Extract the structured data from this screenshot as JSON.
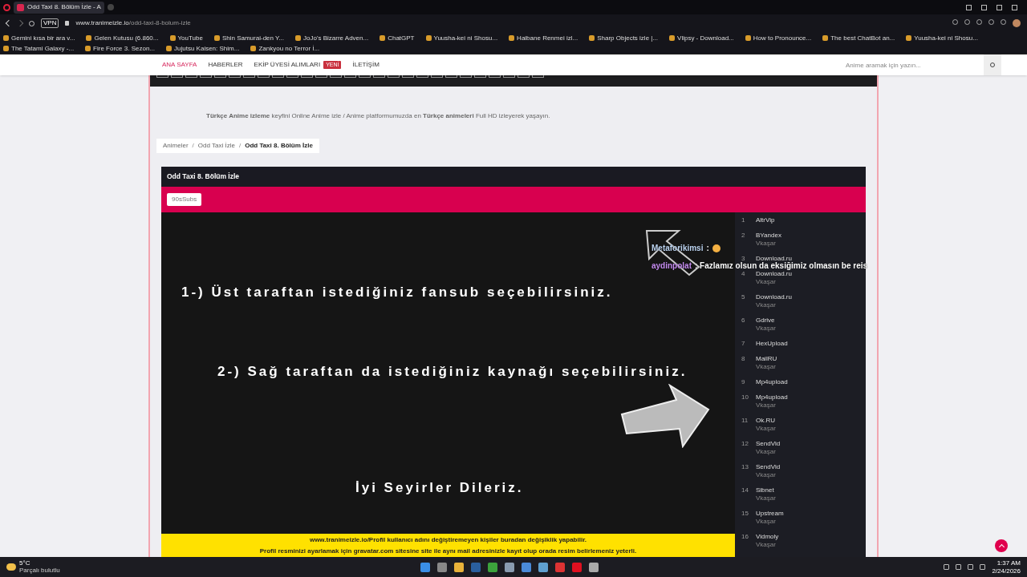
{
  "browser": {
    "tab_title": "Odd Taxi 8. Bölüm İzle - A",
    "url_host": "www.tranimeizle.io",
    "url_path": "/odd-taxi-8-bolum-izle",
    "vpn": "VPN",
    "bookmarks": [
      "Gemini kısa bir ara v...",
      "Gelen Kutusu (6.860...",
      "YouTube",
      "Shin Samurai-den Y...",
      "JoJo's Bizarre Adven...",
      "ChatGPT",
      "Yuusha-kei ni Shosu...",
      "Haibane Renmei izl...",
      "Sharp Objects izle |...",
      "Vlipsy - Download...",
      "How to Pronounce...",
      "The best ChatBot an...",
      "Yuusha-kei ni Shosu...",
      "The Tatami Galaxy -...",
      "Fire Force 3. Sezon...",
      "Jujutsu Kaisen: Shim...",
      "Zankyou no Terror İ..."
    ]
  },
  "nav": {
    "items": [
      {
        "label": "ANA SAYFA",
        "selected": true
      },
      {
        "label": "HABERLER",
        "selected": false
      },
      {
        "label": "EKİP ÜYESİ ALIMLARI",
        "selected": false,
        "badge": "YENİ"
      },
      {
        "label": "İLETİŞİM",
        "selected": false
      }
    ],
    "search": {
      "placeholder": "Anime aramak için yazın..."
    }
  },
  "intro": "**Türkçe Anime izleme** keyfini Online Anime izle / Anime platformumuzda en **Türkçe animeleri** Full HD izleyerek yaşayın.",
  "breadcrumb_separator": "/",
  "breadcrumb": [
    {
      "label": "Animeler",
      "selected": false
    },
    {
      "label": "Odd Taxi İzle",
      "selected": false
    },
    {
      "label": "Odd Taxi 8. Bölüm İzle",
      "selected": true
    }
  ],
  "episode": {
    "title": "Odd Taxi 8. Bölüm İzle",
    "fansubs": [
      {
        "label": "90sSubs",
        "selected": true
      }
    ],
    "player_lines": [
      "1-) Üst taraftan istediğiniz fansub seçebilirsiniz.",
      "2-) Sağ taraftan da istediğiniz kaynağı seçebilirsiniz.",
      "İyi Seyirler Dileriz."
    ],
    "notice": [
      "www.tranimeizle.io/Profil kullanıcı adını değiştiremeyen kişiler buradan değişiklik yapabilir.",
      "Profil resminizi ayarlamak için gravatar.com sitesine site ile aynı mail adresinizle kayıt olup orada resim belirlemeniz yeterli."
    ],
    "sources": [
      {
        "num": "1",
        "name": "AltrVip"
      },
      {
        "num": "2",
        "name": "BYandex",
        "sub": "Vkaşar"
      },
      {
        "num": "3",
        "name": "Download.ru"
      },
      {
        "num": "4",
        "name": "Download.ru",
        "sub": "Vkaşar"
      },
      {
        "num": "5",
        "name": "Download.ru",
        "sub": "Vkaşar"
      },
      {
        "num": "6",
        "name": "Gdrive",
        "sub": "Vkaşar"
      },
      {
        "num": "7",
        "name": "HexUpload"
      },
      {
        "num": "8",
        "name": "MailRU",
        "sub": "Vkaşar"
      },
      {
        "num": "9",
        "name": "Mp4upload"
      },
      {
        "num": "10",
        "name": "Mp4upload",
        "sub": "Vkaşar"
      },
      {
        "num": "11",
        "name": "Ok.RU",
        "sub": "Vkaşar"
      },
      {
        "num": "12",
        "name": "SendVid",
        "sub": "Vkaşar"
      },
      {
        "num": "13",
        "name": "SendVid",
        "sub": "Vkaşar"
      },
      {
        "num": "14",
        "name": "Sibnet",
        "sub": "Vkaşar"
      },
      {
        "num": "15",
        "name": "Upstream",
        "sub": "Vkaşar"
      },
      {
        "num": "16",
        "name": "Vidmoly",
        "sub": "Vkaşar"
      }
    ]
  },
  "chat": [
    {
      "user": "Metaforikimsi",
      "color": "#bcd3f0",
      "text": ":"
    },
    {
      "user": "aydinpolat",
      "color": "#c58cf0",
      "text": ": Fazlamız olsun da eksiğimiz olmasın be reis"
    }
  ],
  "taskbar": {
    "temp": "5°C",
    "weather": "Parçalı bulutlu",
    "time": "1:37 AM",
    "date": "2/24/2026"
  }
}
